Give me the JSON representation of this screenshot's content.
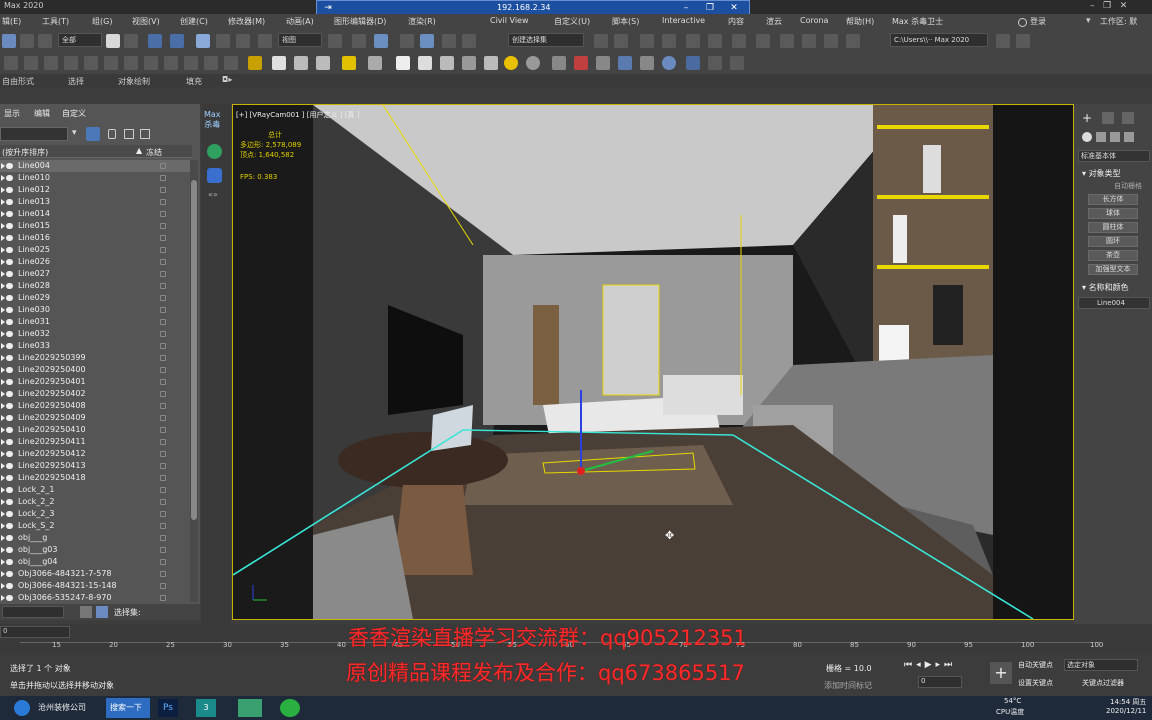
{
  "app": {
    "title": "Max 2020",
    "remote_ip": "192.168.2.34"
  },
  "menubar": {
    "items": [
      "辑(E)",
      "工具(T)",
      "组(G)",
      "视图(V)",
      "创建(C)",
      "修改器(M)",
      "动画(A)",
      "图形编辑器(D)",
      "渲染(R)",
      "Civil View",
      "自定义(U)",
      "脚本(S)",
      "Interactive",
      "内容",
      "渲云",
      "Corona",
      "帮助(H)",
      "Max 杀毒卫士"
    ],
    "login": "登录",
    "workspace": "工作区: 默"
  },
  "toolbar": {
    "filter": "全部",
    "view": "视图",
    "selection_set": "创建选择集",
    "path": "C:\\Users\\\\·· Max 2020"
  },
  "ribbon": {
    "tabs": [
      "自由形式",
      "选择",
      "对象绘制",
      "填充"
    ]
  },
  "explorer": {
    "menu": [
      "显示",
      "编辑",
      "自定义"
    ],
    "header_name": "(按升序排序)",
    "header_freeze": "冻结",
    "rows": [
      "Line004",
      "Line010",
      "Line012",
      "Line013",
      "Line014",
      "Line015",
      "Line016",
      "Line025",
      "Line026",
      "Line027",
      "Line028",
      "Line029",
      "Line030",
      "Line031",
      "Line032",
      "Line033",
      "Line2029250399",
      "Line2029250400",
      "Line2029250401",
      "Line2029250402",
      "Line2029250408",
      "Line2029250409",
      "Line2029250410",
      "Line2029250411",
      "Line2029250412",
      "Line2029250413",
      "Line2029250418",
      "Lock_2_1",
      "Lock_2_2",
      "Lock_2_3",
      "Lock_S_2",
      "obj___g",
      "obj___g03",
      "obj___g04",
      "Obj3066-484321-7-578",
      "Obj3066-484321-15-148",
      "Obj3066-535247-8-970"
    ],
    "selected_index": 0,
    "bottom_label": "选择集:"
  },
  "side": {
    "label": "Max\n杀毒"
  },
  "viewport": {
    "label": "[+] [VRayCam001 ] [用户定义 ] [真 ]",
    "stats_total": "总计",
    "poly_label": "多边形:",
    "poly_value": "2,578,089",
    "vert_label": "顶点:",
    "vert_value": "1,640,582",
    "fps_label": "FPS:",
    "fps_value": "0.383"
  },
  "command_panel": {
    "dropdown": "标准基本体",
    "rollout_object_type": "对象类型",
    "autogrid": "自动栅格",
    "buttons": [
      "长方体",
      "球体",
      "圆柱体",
      "圆环",
      "茶壶",
      "加强型文本"
    ],
    "rollout_name_color": "名称和颜色",
    "name_value": "Line004"
  },
  "timeline": {
    "ticks": [
      "15",
      "20",
      "25",
      "30",
      "35",
      "40",
      "45",
      "50",
      "55",
      "60",
      "65",
      "70",
      "75",
      "80",
      "85",
      "90",
      "95",
      "100"
    ],
    "frame": "0",
    "frame_total": "100"
  },
  "status": {
    "line1": "选择了 1 个 对象",
    "line2": "单击并拖动以选择并移动对象",
    "grid": "栅格 = 10.0",
    "add_time_tag": "添加时间标记",
    "auto_key": "自动关键点",
    "set_key": "设置关键点",
    "selected_obj": "选定对象",
    "key_filter": "关键点过滤器",
    "frame_value": "0"
  },
  "watermark": {
    "line1": "香香渲染直播学习交流群：qq905212351",
    "line2": "原创精品课程发布及合作：qq673865517"
  },
  "taskbar": {
    "items": [
      "沧州装修公司",
      "搜索一下"
    ],
    "temp": "54°C",
    "cpu": "CPU温度",
    "time": "14:54 周五",
    "date": "2020/12/11"
  }
}
